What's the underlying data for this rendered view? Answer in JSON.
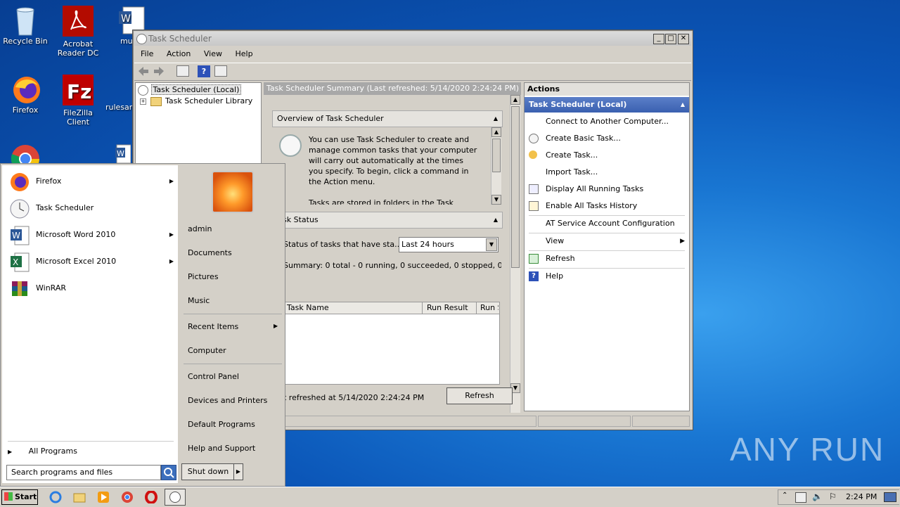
{
  "desktop": {
    "icons": [
      {
        "label": "Recycle Bin"
      },
      {
        "label": "Acrobat Reader DC"
      },
      {
        "label": "multi"
      },
      {
        "label": "Firefox"
      },
      {
        "label": "FileZilla Client"
      },
      {
        "label": "rulesar"
      }
    ],
    "watermark": "ANY RUN"
  },
  "window": {
    "title": "Task Scheduler",
    "menu": [
      "File",
      "Action",
      "View",
      "Help"
    ],
    "tree": {
      "root": "Task Scheduler (Local)",
      "child": "Task Scheduler Library"
    },
    "summary_header": "Task Scheduler Summary (Last refreshed: 5/14/2020 2:24:24 PM)",
    "overview": {
      "title": "Overview of Task Scheduler",
      "text": "You can use Task Scheduler to create and manage common tasks that your computer will carry out automatically at the times you specify. To begin, click a command in the Action menu.",
      "text2": "Tasks are stored in folders in the Task"
    },
    "task_status": {
      "title": "sk Status",
      "status_label": "Status of tasks that have sta...",
      "dropdown_value": "Last 24 hours",
      "summary": "Summary: 0 total - 0 running, 0 succeeded, 0 stopped, 0...",
      "columns": [
        "Task Name",
        "Run Result",
        "Run S"
      ]
    },
    "footer": {
      "last_refreshed": "t refreshed at 5/14/2020 2:24:24 PM",
      "refresh_button": "Refresh"
    },
    "actions": {
      "header": "Actions",
      "section": "Task Scheduler (Local)",
      "items": [
        {
          "label": "Connect to Another Computer...",
          "icon": "none"
        },
        {
          "label": "Create Basic Task...",
          "icon": "clock-icon"
        },
        {
          "label": "Create Task...",
          "icon": "new-task-icon"
        },
        {
          "label": "Import Task...",
          "icon": "none"
        },
        {
          "label": "Display All Running Tasks",
          "icon": "list-icon"
        },
        {
          "label": "Enable All Tasks History",
          "icon": "history-icon"
        },
        {
          "label": "AT Service Account Configuration",
          "icon": "none"
        },
        {
          "label": "View",
          "icon": "none"
        },
        {
          "label": "Refresh",
          "icon": "refresh-icon"
        },
        {
          "label": "Help",
          "icon": "help-icon"
        }
      ]
    }
  },
  "start_menu": {
    "programs": [
      {
        "label": "Firefox",
        "has_submenu": true
      },
      {
        "label": "Task Scheduler",
        "has_submenu": false
      },
      {
        "label": "Microsoft Word 2010",
        "has_submenu": true
      },
      {
        "label": "Microsoft Excel 2010",
        "has_submenu": true
      },
      {
        "label": "WinRAR",
        "has_submenu": false
      }
    ],
    "all_programs": "All Programs",
    "search_placeholder": "Search programs and files",
    "right": [
      "admin",
      "Documents",
      "Pictures",
      "Music",
      "Recent Items",
      "Computer",
      "Control Panel",
      "Devices and Printers",
      "Default Programs",
      "Help and Support"
    ],
    "shutdown": "Shut down"
  },
  "taskbar": {
    "start": "Start",
    "clock": "2:24 PM"
  }
}
